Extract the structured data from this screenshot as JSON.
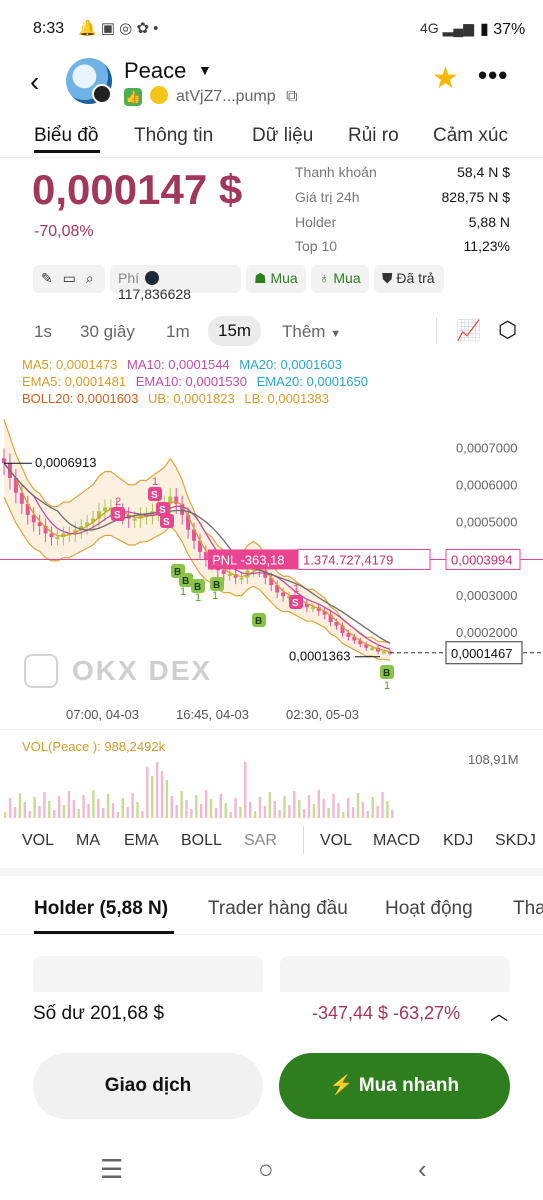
{
  "status_bar": {
    "time": "8:33",
    "network": "4G",
    "battery": "37%"
  },
  "header": {
    "token_name": "Peace",
    "address": "atVjZ7...pump"
  },
  "tabs": [
    {
      "label": "Biểu đồ"
    },
    {
      "label": "Thông tin"
    },
    {
      "label": "Dữ liệu"
    },
    {
      "label": "Rủi ro"
    },
    {
      "label": "Cảm xúc"
    }
  ],
  "price": {
    "value": "0,000147 $",
    "change": "-70,08%"
  },
  "stats": [
    {
      "label": "Thanh khoản",
      "value": "58,4 N $"
    },
    {
      "label": "Giá trị 24h",
      "value": "828,75 N $"
    },
    {
      "label": "Holder",
      "value": "5,88 N"
    },
    {
      "label": "Top 10",
      "value": "11,23%"
    }
  ],
  "chips": {
    "fee_label": "Phí",
    "fee_value": "117,836628",
    "buy1": "Mua",
    "buy2": "Mua",
    "paid": "Đã trả"
  },
  "intervals": {
    "items": [
      "1s",
      "30 giây",
      "1m",
      "15m"
    ],
    "more": "Thêm"
  },
  "indicators": {
    "ma5": "MA5: 0,0001473",
    "ma10": "MA10: 0,0001544",
    "ma20": "MA20: 0,0001603",
    "ema5": "EMA5: 0,0001481",
    "ema10": "EMA10: 0,0001530",
    "ema20": "EMA20: 0,0001650",
    "boll20": "BOLL20: 0,0001603",
    "ub": "UB: 0,0001823",
    "lb": "LB: 0,0001383"
  },
  "chart": {
    "high_label": "0,0006913",
    "low_label": "0,0001363",
    "pnl_label": "PNL -363,18",
    "pnl_amount": "1.374.727,4179",
    "pnl_price": "0,0003994",
    "current_price": "0,0001467",
    "watermark": "DEX",
    "time_labels": [
      "07:00, 04-03",
      "16:45, 04-03",
      "02:30, 05-03"
    ]
  },
  "chart_data": {
    "type": "candlestick",
    "y_axis_ticks": [
      "0,0007000",
      "0,0006000",
      "0,0005000",
      "0,0004000",
      "0,0003000",
      "0,0002000"
    ],
    "ylim": [
      0.0001,
      0.00075
    ],
    "close_series": [
      0.00066,
      0.00062,
      0.00058,
      0.00055,
      0.00052,
      0.0005,
      0.00049,
      0.00047,
      0.00046,
      0.00046,
      0.00047,
      0.00047,
      0.00048,
      0.00049,
      0.0005,
      0.00051,
      0.00053,
      0.00054,
      0.00054,
      0.00053,
      0.00052,
      0.00051,
      0.00051,
      0.00052,
      0.00052,
      0.00053,
      0.00054,
      0.00055,
      0.00057,
      0.00055,
      0.00052,
      0.00048,
      0.00045,
      0.00042,
      0.0004,
      0.00039,
      0.00037,
      0.00036,
      0.00036,
      0.00035,
      0.00035,
      0.00037,
      0.00038,
      0.00037,
      0.00035,
      0.00033,
      0.00031,
      0.0003,
      0.0003,
      0.00029,
      0.00028,
      0.00027,
      0.00027,
      0.00026,
      0.00025,
      0.00023,
      0.00022,
      0.0002,
      0.00019,
      0.00018,
      0.00017,
      0.00016,
      0.00016,
      0.00015,
      0.00015,
      0.000147
    ],
    "volume_max": "108,91M",
    "trade_markers": {
      "sells": [
        "2",
        "1",
        "1"
      ],
      "buys": [
        "1",
        "1",
        "1",
        "1"
      ]
    }
  },
  "volume": {
    "label": "VOL(Peace ): 988,2492k",
    "max": "108,91M"
  },
  "indicator_tabs": [
    "VOL",
    "MA",
    "EMA",
    "BOLL",
    "SAR",
    "VOL",
    "MACD",
    "KDJ",
    "SKDJ"
  ],
  "sub_tabs": [
    "Holder (5,88 N)",
    "Trader hàng đầu",
    "Hoạt động",
    "Tha"
  ],
  "balance": {
    "label": "Số dư 201,68 $",
    "pnl": "-347,44 $ -63,27%"
  },
  "buttons": {
    "trade": "Giao dịch",
    "quick_buy": "Mua nhanh"
  },
  "colors": {
    "down": "#a2375d",
    "buy_button": "#2e7d1e",
    "star": "#f6b800",
    "pnl_pink": "#e9448f"
  }
}
